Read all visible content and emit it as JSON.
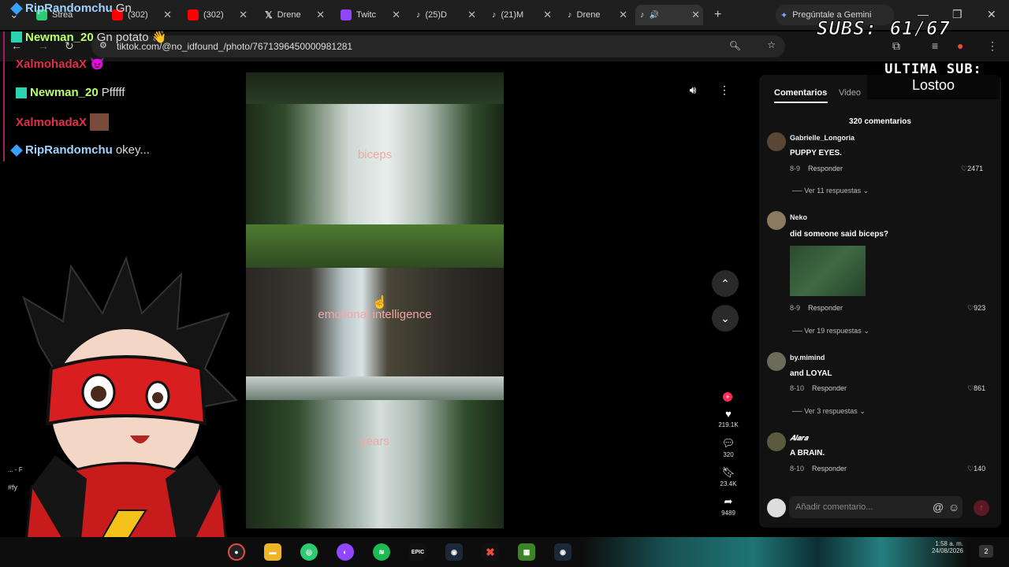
{
  "browser": {
    "tabs": [
      {
        "label": "Strea",
        "color": "#2ecc71"
      },
      {
        "label": "(302)",
        "color": "#ff0000"
      },
      {
        "label": "(302)",
        "color": "#ff0000"
      },
      {
        "label": "Drene",
        "color": "#ffffff"
      },
      {
        "label": "Twitc",
        "color": "#9146ff"
      },
      {
        "label": "(25)D",
        "color": "#ffffff"
      },
      {
        "label": "(21)M",
        "color": "#ffffff"
      },
      {
        "label": "Drene",
        "color": "#ffffff"
      },
      {
        "label": "",
        "color": "#ffffff"
      }
    ],
    "gemini_label": "Pregúntale a Gemini",
    "url": "tiktok.com/@no_idfound_/photo/7671396450000981281"
  },
  "video": {
    "words": [
      "biceps",
      "emotional intelligence",
      "years"
    ]
  },
  "actions": {
    "likes": "219.1K",
    "comments": "320",
    "saves": "23.4K",
    "shares": "9489"
  },
  "panel": {
    "tab_comments": "Comentarios",
    "tab_videos": "Video",
    "count": "320 comentarios",
    "comments": [
      {
        "user": "Gabrielle_Longoria",
        "text": "PUPPY EYES.",
        "date": "8-9",
        "reply": "Responder",
        "likes": "2471",
        "more": "Ver 11 respuestas"
      },
      {
        "user": "Neko",
        "text": "did someone said biceps?",
        "date": "8-9",
        "reply": "Responder",
        "likes": "923",
        "more": "Ver 19 respuestas"
      },
      {
        "user": "by.mimind",
        "text": "and LOYAL",
        "date": "8-10",
        "reply": "Responder",
        "likes": "861",
        "more": "Ver 3 respuestas"
      },
      {
        "user": "𝑨𝒍𝒂𝒓𝒂",
        "text": "A BRAIN.",
        "date": "8-10",
        "reply": "Responder",
        "likes": "140",
        "more": ""
      }
    ],
    "input_placeholder": "Añadir comentario..."
  },
  "chat": [
    {
      "user": "RipRandomchu",
      "msg": "Gn",
      "color": "#9fd3ff"
    },
    {
      "user": "Newman_20",
      "msg": "Gn potato 👋",
      "color": "#b8ff6a"
    },
    {
      "user": "XalmohadaX",
      "msg": "",
      "color": "#e0304a"
    },
    {
      "user": "Newman_20",
      "msg": "Pfffff",
      "color": "#b8ff6a"
    },
    {
      "user": "XalmohadaX",
      "msg": "",
      "color": "#e0304a"
    },
    {
      "user": "RipRandomchu",
      "msg": "okey...",
      "color": "#9fd3ff"
    }
  ],
  "overlay": {
    "subs": "SUBS: 61/67",
    "last_sub_label": "ULTIMA SUB:",
    "last_sub_name": "Lostoo",
    "side_text_1": "... - F",
    "side_text_2": "#fy"
  },
  "taskbar": {
    "time": "1:58 a. m.",
    "date": "24/08/2026",
    "notif": "2"
  }
}
